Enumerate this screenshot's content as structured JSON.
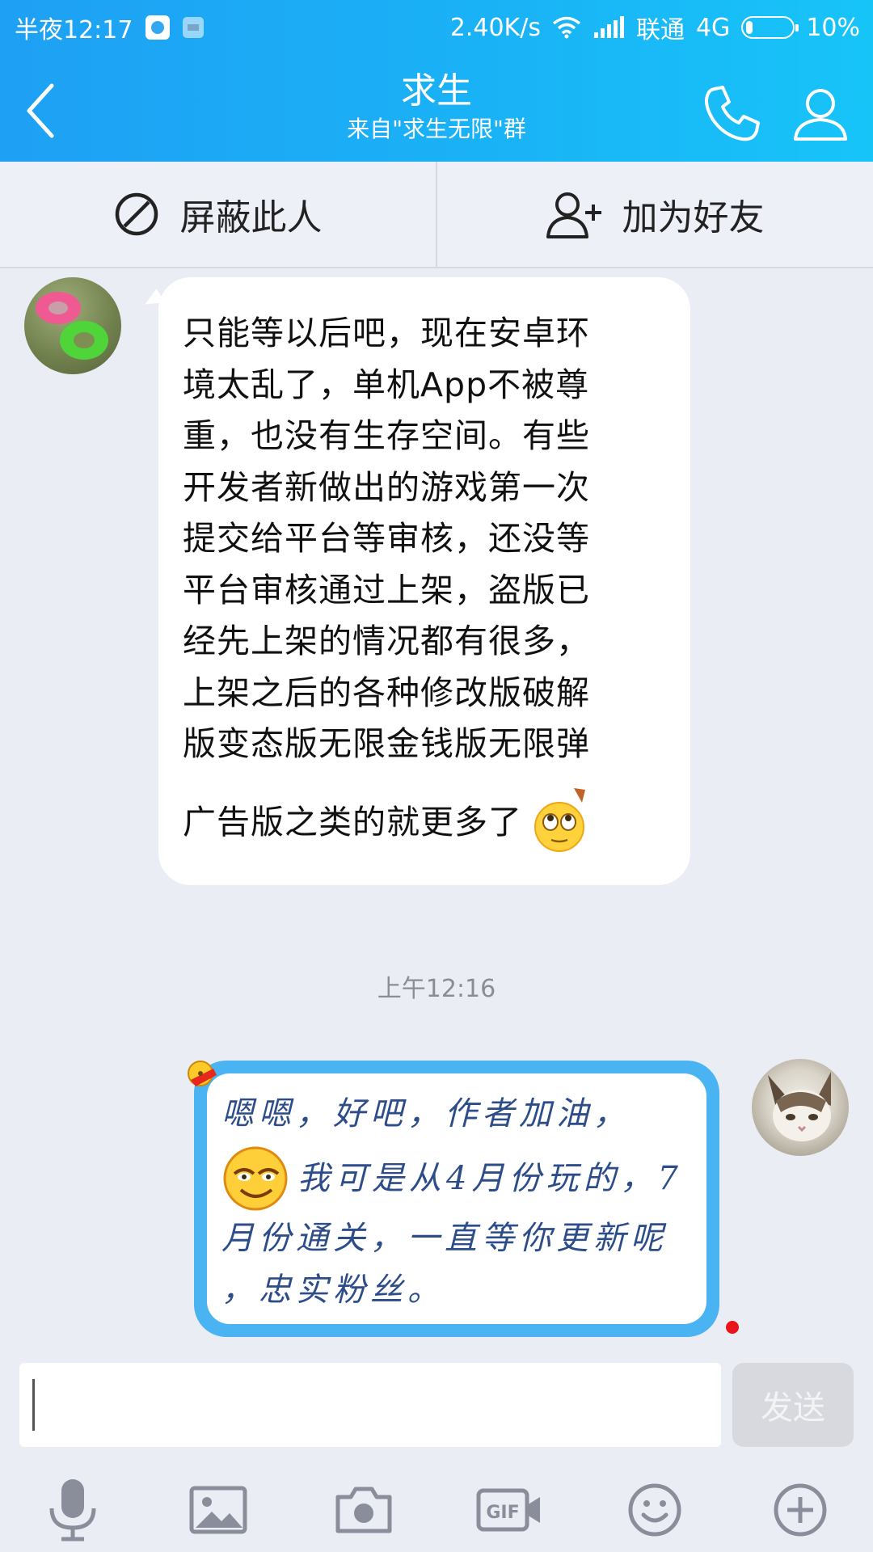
{
  "status_bar": {
    "time": "半夜12:17",
    "network_speed": "2.40K/s",
    "carrier": "联通",
    "network_type": "4G",
    "battery": "10%",
    "battery_level": 0.1
  },
  "header": {
    "title": "求生",
    "subtitle": "来自\"求生无限\"群"
  },
  "actions": {
    "block_label": "屏蔽此人",
    "add_friend_label": "加为好友"
  },
  "messages": [
    {
      "side": "left",
      "text": "只能等以后吧，现在安卓环\n境太乱了，单机App不被尊\n重，也没有生存空间。有些\n开发者新做出的游戏第一次\n提交给平台等审核，还没等\n平台审核通过上架，盗版已\n经先上架的情况都有很多，\n上架之后的各种修改版破解\n版变态版无限金钱版无限弹",
      "last_line": "广告版之类的就更多了",
      "emoji": "rolling-eyes-emoji"
    },
    {
      "side": "right",
      "line1": "嗯嗯，好吧，作者加油，",
      "line2": "我可是从4月份玩的，7",
      "line3": "月份通关，一直等你更新呢",
      "line4": "，忠实粉丝。",
      "emoji": "sly-smile-emoji"
    }
  ],
  "timestamp": "上午12:16",
  "input": {
    "value": "",
    "send_label": "发送"
  },
  "toolbar": [
    "microphone-icon",
    "image-icon",
    "camera-icon",
    "gif-icon",
    "emoji-icon",
    "plus-icon"
  ],
  "colors": {
    "header_gradient_start": "#1ea0f4",
    "header_gradient_end": "#17c4f8",
    "chat_background": "#ebedf5",
    "bubble_border_blue": "#4ab3f2",
    "right_text_color": "#2c4d8a"
  }
}
